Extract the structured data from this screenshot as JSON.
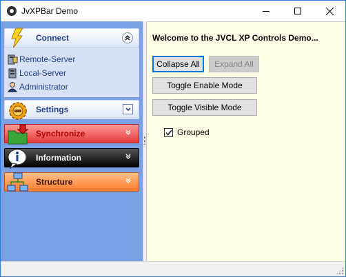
{
  "window": {
    "title": "JvXPBar Demo",
    "app_icon": "paw-icon"
  },
  "sidebar": {
    "groups": [
      {
        "label": "Connect",
        "icon": "lightning-icon",
        "state": "expanded",
        "items": [
          {
            "label": "Remote-Server",
            "icon": "remote-server-icon"
          },
          {
            "label": "Local-Server",
            "icon": "local-server-icon"
          },
          {
            "label": "Administrator",
            "icon": "administrator-icon"
          }
        ]
      },
      {
        "label": "Settings",
        "icon": "gear-icon",
        "state": "collapsed"
      },
      {
        "label": "Synchronize",
        "icon": "sync-folder-icon",
        "state": "collapsed"
      },
      {
        "label": "Information",
        "icon": "info-icon",
        "state": "collapsed"
      },
      {
        "label": "Structure",
        "icon": "network-icon",
        "state": "collapsed"
      }
    ]
  },
  "main": {
    "welcome": "Welcome to the JVCL XP Controls Demo...",
    "buttons": {
      "collapse_all": "Collapse All",
      "expand_all": "Expand All",
      "toggle_enable": "Toggle Enable Mode",
      "toggle_visible": "Toggle Visible Mode"
    },
    "grouped": {
      "label": "Grouped",
      "checked": true
    }
  },
  "colors": {
    "sidebar_bg": "#7aa1e6",
    "content_bg": "#ffffe7",
    "synchronize": "#e63a3a",
    "information": "#000000",
    "structure": "#ff7a2a"
  }
}
